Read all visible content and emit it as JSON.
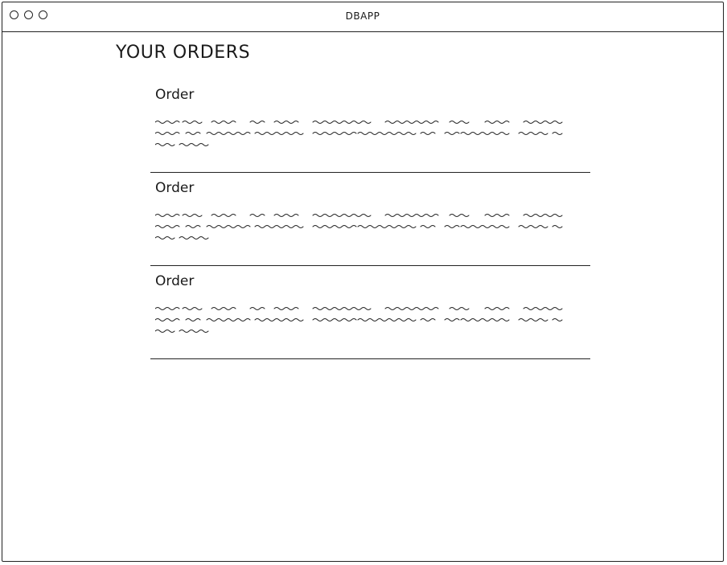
{
  "window": {
    "title": "DBAPP"
  },
  "page": {
    "title": "YOUR ORDERS"
  },
  "orders": [
    {
      "title": "Order"
    },
    {
      "title": "Order"
    },
    {
      "title": "Order"
    }
  ],
  "colors": {
    "ink": "#222222",
    "background": "#ffffff"
  }
}
